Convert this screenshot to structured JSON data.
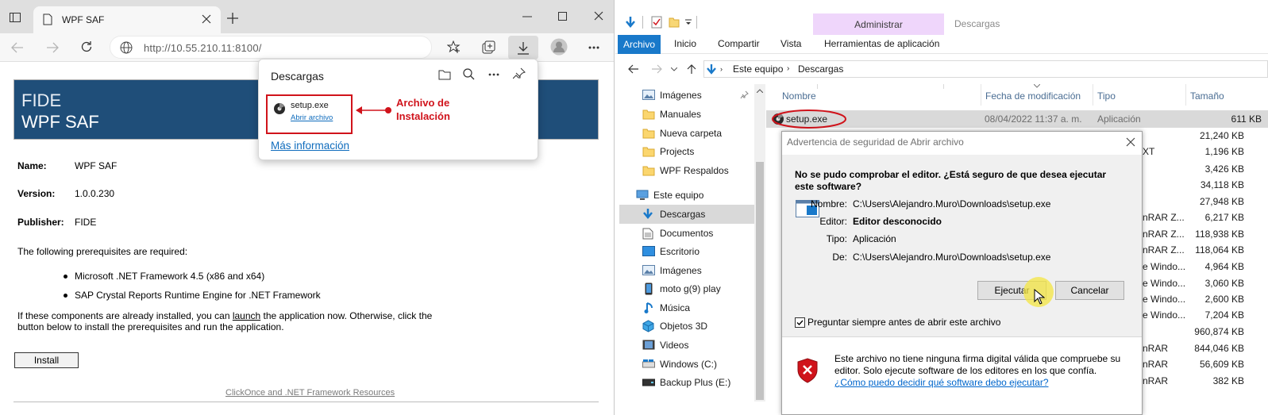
{
  "browser": {
    "tab_title": "WPF SAF",
    "url": "http://10.55.210.11:8100/",
    "downloads_panel": {
      "title": "Descargas",
      "file_name": "setup.exe",
      "open_link": "Abrir archivo",
      "more_info": "Más información",
      "annotation": "Archivo de Instalación"
    },
    "page": {
      "header_line1": "FIDE",
      "header_line2": "WPF SAF",
      "name_label": "Name:",
      "name_value": "WPF SAF",
      "version_label": "Version:",
      "version_value": "1.0.0.230",
      "publisher_label": "Publisher:",
      "publisher_value": "FIDE",
      "prereq_intro": "The following prerequisites are required:",
      "prerequisites": [
        "Microsoft .NET Framework 4.5 (x86 and x64)",
        "SAP Crystal Reports Runtime Engine for .NET Framework"
      ],
      "para_before": "If these components are already installed, you can ",
      "para_link": "launch",
      "para_after": " the application now. Otherwise, click the button below to install the prerequisites and run the application.",
      "install_button": "Install",
      "footer_link": "ClickOnce and .NET Framework Resources"
    }
  },
  "explorer": {
    "contextual_tab_group": "Administrar",
    "window_title": "Descargas",
    "ribbon_tabs": [
      "Archivo",
      "Inicio",
      "Compartir",
      "Vista",
      "Herramientas de aplicación"
    ],
    "breadcrumb": [
      "Este equipo",
      "Descargas"
    ],
    "tree": [
      {
        "label": "Imágenes",
        "icon": "pictures-icon"
      },
      {
        "label": "Manuales",
        "icon": "folder-icon"
      },
      {
        "label": "Nueva carpeta",
        "icon": "folder-icon"
      },
      {
        "label": "Projects",
        "icon": "folder-icon"
      },
      {
        "label": "WPF Respaldos",
        "icon": "folder-icon"
      },
      {
        "label": "Este equipo",
        "icon": "computer-icon"
      },
      {
        "label": "Descargas",
        "icon": "download-arrow-icon"
      },
      {
        "label": "Documentos",
        "icon": "documents-icon"
      },
      {
        "label": "Escritorio",
        "icon": "desktop-icon"
      },
      {
        "label": "Imágenes",
        "icon": "pictures-icon"
      },
      {
        "label": "moto g(9) play",
        "icon": "phone-icon"
      },
      {
        "label": "Música",
        "icon": "music-icon"
      },
      {
        "label": "Objetos 3D",
        "icon": "cube-icon"
      },
      {
        "label": "Videos",
        "icon": "video-icon"
      },
      {
        "label": "Windows  (C:)",
        "icon": "drive-icon"
      },
      {
        "label": "Backup Plus  (E:)",
        "icon": "drive-icon"
      }
    ],
    "columns": [
      "Nombre",
      "Fecha de modificación",
      "Tipo",
      "Tamaño"
    ],
    "selected_file": {
      "name": "setup.exe",
      "date": "08/04/2022 11:37 a. m.",
      "type": "Aplicación",
      "size": "611 KB"
    },
    "sizes": [
      "21,240 KB",
      "1,196 KB",
      "3,426 KB",
      "34,118 KB",
      "27,948 KB",
      "6,217 KB",
      "118,938 KB",
      "118,064 KB",
      "4,964 KB",
      "3,060 KB",
      "2,600 KB",
      "7,204 KB",
      "960,874 KB",
      "844,046 KB",
      "56,609 KB",
      "382 KB"
    ],
    "type_fragments": [
      "XT",
      "nRAR Z...",
      "nRAR Z...",
      "nRAR Z...",
      "e Windo...",
      "e Windo...",
      "e Windo...",
      "e Windo...",
      "nRAR",
      "nRAR",
      "nRAR"
    ]
  },
  "dialog": {
    "title": "Advertencia de seguridad de Abrir archivo",
    "question": "No se pudo comprobar el editor. ¿Está seguro de que desea ejecutar este software?",
    "name_label": "Nombre:",
    "name_value": "C:\\Users\\Alejandro.Muro\\Downloads\\setup.exe",
    "editor_label": "Editor:",
    "editor_value": "Editor desconocido",
    "type_label": "Tipo:",
    "type_value": "Aplicación",
    "from_label": "De:",
    "from_value": "C:\\Users\\Alejandro.Muro\\Downloads\\setup.exe",
    "run_button": "Ejecutar",
    "cancel_button": "Cancelar",
    "always_ask": "Preguntar siempre antes de abrir este archivo",
    "always_ask_checked": true,
    "warning_text": "Este archivo no tiene ninguna firma digital válida que compruebe su editor. Solo ejecute software de los editores en los que confía. ",
    "warning_link": "¿Cómo puedo decidir qué software debo ejecutar?"
  },
  "colors": {
    "accent_blue": "#1979ca",
    "fide_header": "#1f4e79",
    "annotation_red": "#d0131b",
    "contextual_tab": "#efd6fb",
    "cursor_highlight": "#f4e542"
  }
}
